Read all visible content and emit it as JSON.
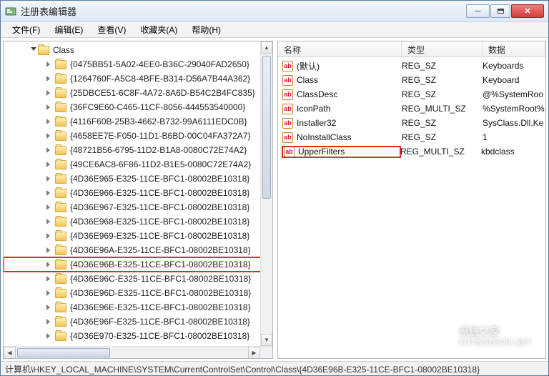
{
  "window": {
    "title": "注册表编辑器",
    "minimize_glyph": "─",
    "close_glyph": "✕"
  },
  "menu": {
    "file": "文件(F)",
    "edit": "编辑(E)",
    "view": "查看(V)",
    "favorites": "收藏夹(A)",
    "help": "帮助(H)"
  },
  "tree": {
    "parent": "Class",
    "items": [
      "{0475BB51-5A02-4EE0-B36C-29040FAD2650}",
      "{1264760F-A5C8-4BFE-B314-D56A7B44A362}",
      "{25DBCE51-6C8F-4A72-8A6D-B54C2B4FC835}",
      "{36FC9E60-C465-11CF-8056-444553540000}",
      "{4116F60B-25B3-4662-B732-99A6111EDC0B}",
      "{4658EE7E-F050-11D1-B6BD-00C04FA372A7}",
      "{48721B56-6795-11D2-B1A8-0080C72E74A2}",
      "{49CE6AC8-6F86-11D2-B1E5-0080C72E74A2}",
      "{4D36E965-E325-11CE-BFC1-08002BE10318}",
      "{4D36E966-E325-11CE-BFC1-08002BE10318}",
      "{4D36E967-E325-11CE-BFC1-08002BE10318}",
      "{4D36E968-E325-11CE-BFC1-08002BE10318}",
      "{4D36E969-E325-11CE-BFC1-08002BE10318}",
      "{4D36E96A-E325-11CE-BFC1-08002BE10318}",
      "{4D36E96B-E325-11CE-BFC1-08002BE10318}",
      "{4D36E96C-E325-11CE-BFC1-08002BE10318}",
      "{4D36E96D-E325-11CE-BFC1-08002BE10318}",
      "{4D36E96E-E325-11CE-BFC1-08002BE10318}",
      "{4D36E96F-E325-11CE-BFC1-08002BE10318}",
      "{4D36E970-E325-11CE-BFC1-08002BE10318}"
    ],
    "highlight_index": 14
  },
  "list": {
    "headers": {
      "name": "名称",
      "type": "类型",
      "data": "数据"
    },
    "rows": [
      {
        "name": "(默认)",
        "type": "REG_SZ",
        "data": "Keyboards"
      },
      {
        "name": "Class",
        "type": "REG_SZ",
        "data": "Keyboard"
      },
      {
        "name": "ClassDesc",
        "type": "REG_SZ",
        "data": "@%SystemRoo"
      },
      {
        "name": "IconPath",
        "type": "REG_MULTI_SZ",
        "data": "%SystemRoot%"
      },
      {
        "name": "Installer32",
        "type": "REG_SZ",
        "data": "SysClass.Dll,Ke"
      },
      {
        "name": "NoInstallClass",
        "type": "REG_SZ",
        "data": "1"
      },
      {
        "name": "UpperFilters",
        "type": "REG_MULTI_SZ",
        "data": "kbdclass"
      }
    ],
    "highlight_index": 6
  },
  "status": {
    "path": "计算机\\HKEY_LOCAL_MACHINE\\SYSTEM\\CurrentControlSet\\Control\\Class\\{4D36E96B-E325-11CE-BFC1-08002BE10318}"
  },
  "watermark": {
    "text": "系统之家",
    "url": "XITONGZHIJIA.NET"
  },
  "icon": {
    "ab": "ab"
  }
}
